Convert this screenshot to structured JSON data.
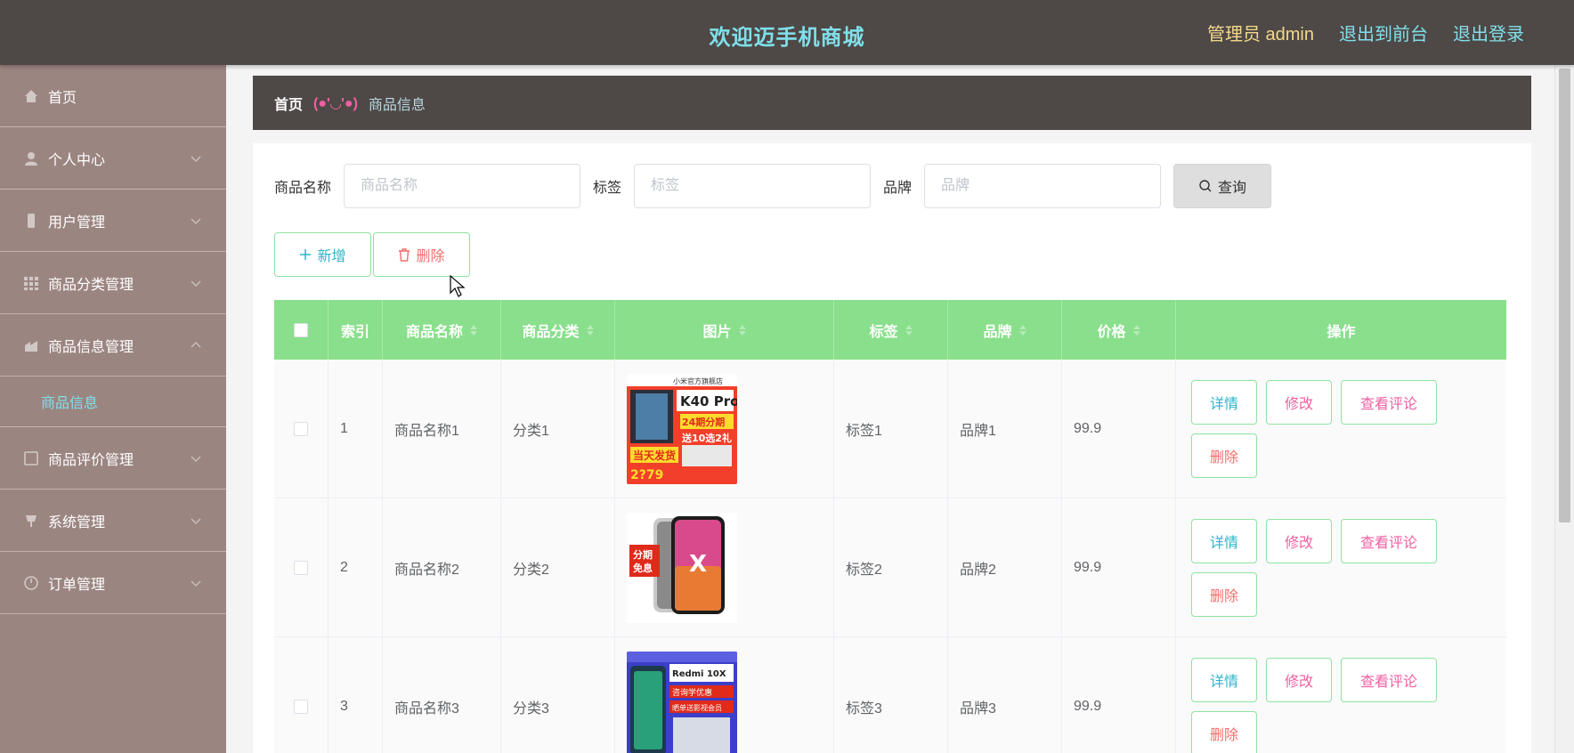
{
  "header": {
    "title": "欢迎迈手机商城",
    "user": "管理员 admin",
    "front_link": "退出到前台",
    "logout_link": "退出登录"
  },
  "sidebar": {
    "items": [
      {
        "label": "首页",
        "icon": "home-icon"
      },
      {
        "label": "个人中心",
        "icon": "user-icon"
      },
      {
        "label": "用户管理",
        "icon": "phone-icon"
      },
      {
        "label": "商品分类管理",
        "icon": "grid-icon"
      },
      {
        "label": "商品信息管理",
        "icon": "goods-icon"
      },
      {
        "label": "商品信息",
        "icon": ""
      },
      {
        "label": "商品评价管理",
        "icon": "comment-icon"
      },
      {
        "label": "系统管理",
        "icon": "system-icon"
      },
      {
        "label": "订单管理",
        "icon": "order-icon"
      }
    ]
  },
  "breadcrumb": {
    "home": "首页",
    "separator": "(●'◡'●)",
    "current": "商品信息"
  },
  "search": {
    "name_label": "商品名称",
    "name_placeholder": "商品名称",
    "tag_label": "标签",
    "tag_placeholder": "标签",
    "brand_label": "品牌",
    "brand_placeholder": "品牌",
    "query_button": "查询"
  },
  "actions": {
    "add": "新增",
    "delete": "删除"
  },
  "table": {
    "headers": [
      "",
      "索引",
      "商品名称",
      "商品分类",
      "图片",
      "标签",
      "品牌",
      "价格",
      "操作"
    ],
    "rows": [
      {
        "index": "1",
        "name": "商品名称1",
        "category": "分类1",
        "tag": "标签1",
        "brand": "品牌1",
        "price": "99.9",
        "img_text": {
          "a": "小米官方旗舰店",
          "b": "K40 Pro",
          "c": "24期分期",
          "d": "送10选2礼",
          "e": "当天发货",
          "f": "2?79"
        }
      },
      {
        "index": "2",
        "name": "商品名称2",
        "category": "分类2",
        "tag": "标签2",
        "brand": "品牌2",
        "price": "99.9",
        "img_text": {
          "a": "分期",
          "b": "免息",
          "c": "X"
        }
      },
      {
        "index": "3",
        "name": "商品名称3",
        "category": "分类3",
        "tag": "标签3",
        "brand": "品牌3",
        "price": "99.9",
        "img_text": {
          "a": "Redmi 10X",
          "b": "咨询学优惠",
          "c": "晒单送影视会员"
        }
      }
    ],
    "ops": {
      "detail": "详情",
      "edit": "修改",
      "review": "查看评论",
      "delete": "删除"
    }
  },
  "colors": {
    "topbar": "#4e4846",
    "sidebar": "#9b8581",
    "table_header": "#89df8b",
    "accent_cyan": "#7fe0ea",
    "accent_pink": "#f15fa2"
  }
}
